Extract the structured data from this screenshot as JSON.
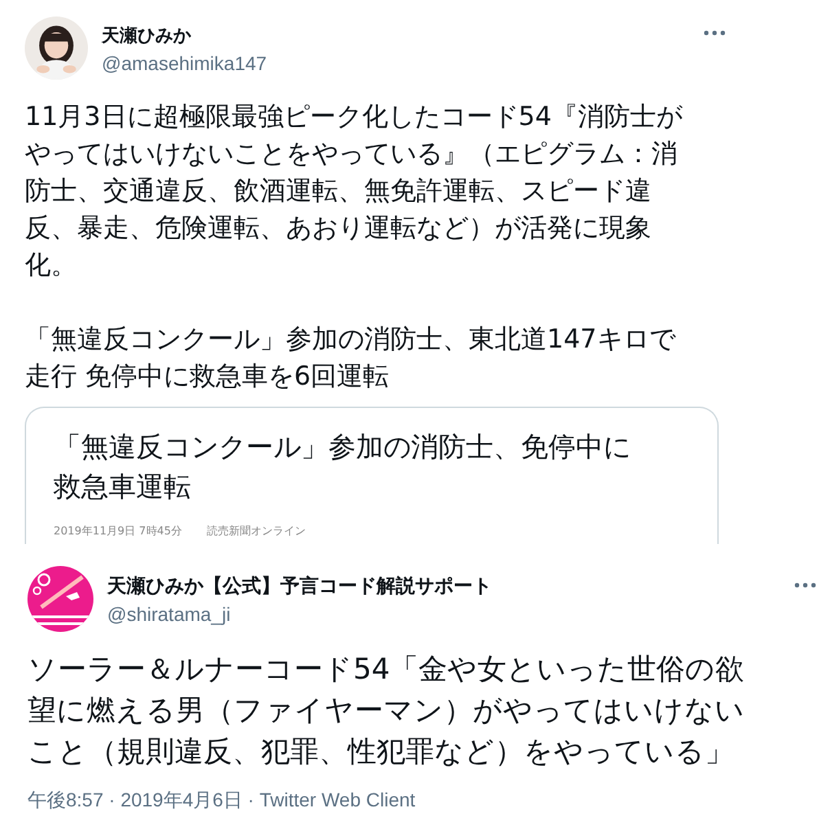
{
  "tweet": {
    "author": {
      "name": "天瀬ひみか",
      "handle": "@amasehimika147"
    },
    "paragraphs": [
      "11月3日に超極限最強ピーク化したコード54『消防士がやってはいけないことをやっている』（エピグラム：消防士、交通違反、飲酒運転、無免許運転、スピード違反、暴走、危険運転、あおり運転など）が活発に現象化。",
      "「無違反コンクール」参加の消防士、東北道147キロで走行 免停中に救急車を6回運転"
    ],
    "link_card": {
      "headline": "「無違反コンクール」参加の消防士、免停中に救急車運転",
      "date": "2019年11月9日 7時45分",
      "source": "読売新聞オンライン"
    }
  },
  "quoted_tweet": {
    "author": {
      "name": "天瀬ひみか【公式】予言コード解説サポート",
      "handle": "@shiratama_ji"
    },
    "text": "ソーラー＆ルナーコード54「金や女といった世俗の欲望に燃える男（ファイヤーマン）がやってはいけないこと（規則違反、犯罪、性犯罪など）をやっている」",
    "footer": "午後8:57 · 2019年4月6日 · Twitter Web Client"
  }
}
